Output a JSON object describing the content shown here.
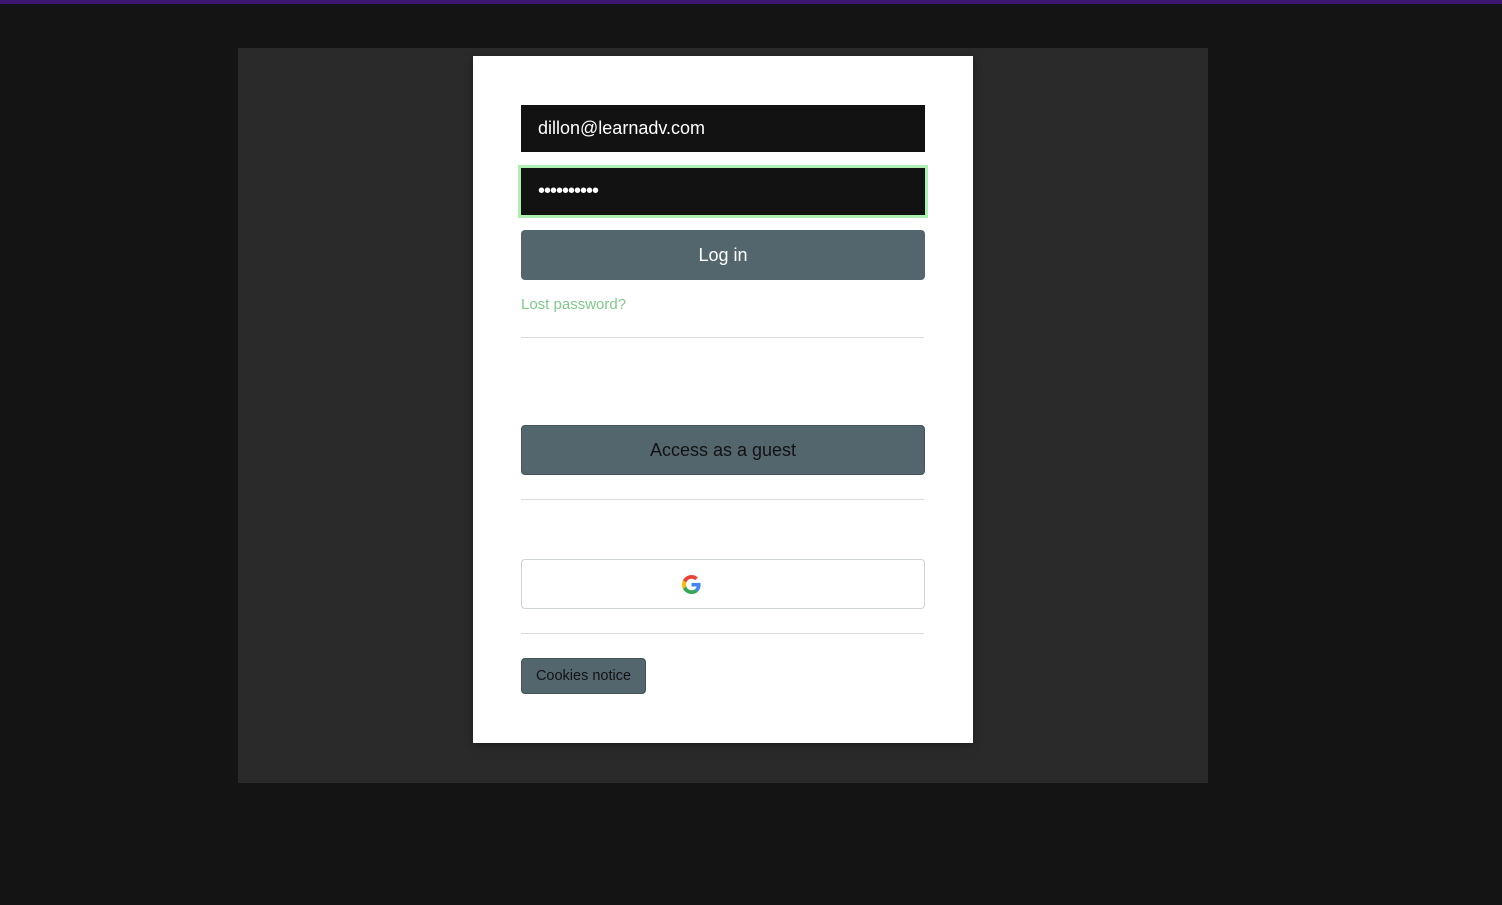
{
  "login": {
    "username_value": "dillon@learnadv.com",
    "password_value": "••••••••••",
    "login_button_label": "Log in",
    "lost_password_link": "Lost password?"
  },
  "guest": {
    "button_label": "Access as a guest"
  },
  "identity_providers": {
    "google_icon": "google-icon"
  },
  "footer": {
    "cookies_button_label": "Cookies notice"
  },
  "colors": {
    "page_bg": "#141414",
    "container_bg": "#2a2a2a",
    "card_bg": "#ffffff",
    "input_bg": "#121212",
    "focus_ring": "#aef0b2",
    "button_bg": "#53666d",
    "link": "#7fc98a",
    "top_strip": "#3a1670"
  }
}
